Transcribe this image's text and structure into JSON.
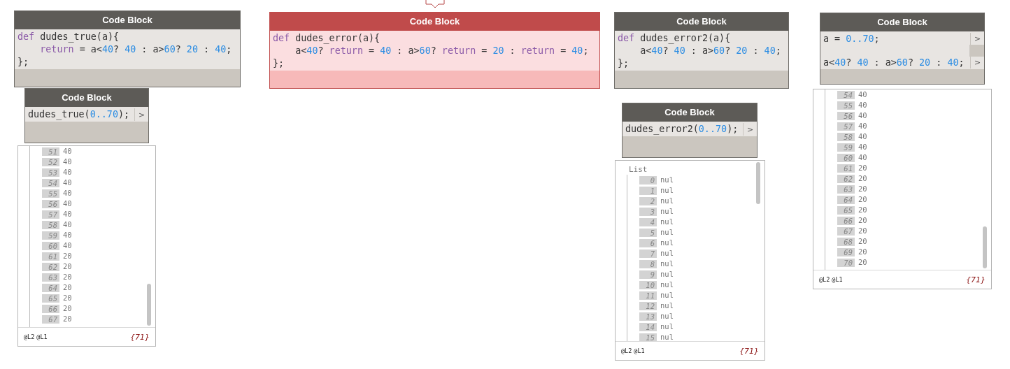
{
  "nodes": [
    {
      "kind": "definition",
      "title": "Code Block",
      "error": false,
      "lines": [
        {
          "indented": false,
          "tokens": [
            {
              "kind": "keyword",
              "text": "def"
            },
            {
              "kind": "plain",
              "text": " dudes_true(a){"
            }
          ]
        },
        {
          "indented": true,
          "tokens": [
            {
              "kind": "keyword",
              "text": "return"
            },
            {
              "kind": "plain",
              "text": " = a<"
            },
            {
              "kind": "number",
              "text": "40"
            },
            {
              "kind": "plain",
              "text": "? "
            },
            {
              "kind": "number",
              "text": "40"
            },
            {
              "kind": "plain",
              "text": " : a>"
            },
            {
              "kind": "number",
              "text": "60"
            },
            {
              "kind": "plain",
              "text": "? "
            },
            {
              "kind": "number",
              "text": "20"
            },
            {
              "kind": "plain",
              "text": " : "
            },
            {
              "kind": "number",
              "text": "40"
            },
            {
              "kind": "plain",
              "text": ";"
            }
          ]
        },
        {
          "indented": false,
          "tokens": [
            {
              "kind": "plain",
              "text": "};"
            }
          ]
        }
      ]
    },
    {
      "kind": "call",
      "title": "Code Block",
      "error": false,
      "lines": [
        {
          "indented": false,
          "output_port": ">",
          "tokens": [
            {
              "kind": "plain",
              "text": "dudes_true("
            },
            {
              "kind": "number",
              "text": "0..70"
            },
            {
              "kind": "plain",
              "text": ");"
            }
          ]
        }
      ]
    },
    {
      "kind": "definition",
      "title": "Code Block",
      "error": true,
      "lines": [
        {
          "indented": false,
          "tokens": [
            {
              "kind": "keyword",
              "text": "def"
            },
            {
              "kind": "plain",
              "text": " dudes_error(a){"
            }
          ]
        },
        {
          "indented": true,
          "tokens": [
            {
              "kind": "plain",
              "text": "a<"
            },
            {
              "kind": "number",
              "text": "40"
            },
            {
              "kind": "plain",
              "text": "? "
            },
            {
              "kind": "keyword",
              "text": "return"
            },
            {
              "kind": "plain",
              "text": " = "
            },
            {
              "kind": "number",
              "text": "40"
            },
            {
              "kind": "plain",
              "text": " : a>"
            },
            {
              "kind": "number",
              "text": "60"
            },
            {
              "kind": "plain",
              "text": "? "
            },
            {
              "kind": "keyword",
              "text": "return"
            },
            {
              "kind": "plain",
              "text": " = "
            },
            {
              "kind": "number",
              "text": "20"
            },
            {
              "kind": "plain",
              "text": " : "
            },
            {
              "kind": "keyword",
              "text": "return"
            },
            {
              "kind": "plain",
              "text": " = "
            },
            {
              "kind": "number",
              "text": "40"
            },
            {
              "kind": "plain",
              "text": ";"
            }
          ]
        },
        {
          "indented": false,
          "tokens": [
            {
              "kind": "plain",
              "text": "};"
            }
          ]
        }
      ]
    },
    {
      "kind": "definition",
      "title": "Code Block",
      "error": false,
      "lines": [
        {
          "indented": false,
          "tokens": [
            {
              "kind": "keyword",
              "text": "def"
            },
            {
              "kind": "plain",
              "text": " dudes_error2(a){"
            }
          ]
        },
        {
          "indented": true,
          "tokens": [
            {
              "kind": "plain",
              "text": "a<"
            },
            {
              "kind": "number",
              "text": "40"
            },
            {
              "kind": "plain",
              "text": "? "
            },
            {
              "kind": "number",
              "text": "40"
            },
            {
              "kind": "plain",
              "text": " : a>"
            },
            {
              "kind": "number",
              "text": "60"
            },
            {
              "kind": "plain",
              "text": "? "
            },
            {
              "kind": "number",
              "text": "20"
            },
            {
              "kind": "plain",
              "text": " : "
            },
            {
              "kind": "number",
              "text": "40"
            },
            {
              "kind": "plain",
              "text": ";"
            }
          ]
        },
        {
          "indented": false,
          "tokens": [
            {
              "kind": "plain",
              "text": "};"
            }
          ]
        }
      ]
    },
    {
      "kind": "call",
      "title": "Code Block",
      "error": false,
      "lines": [
        {
          "indented": false,
          "output_port": ">",
          "tokens": [
            {
              "kind": "plain",
              "text": "dudes_error2("
            },
            {
              "kind": "number",
              "text": "0..70"
            },
            {
              "kind": "plain",
              "text": ");"
            }
          ]
        }
      ]
    },
    {
      "kind": "call",
      "title": "Code Block",
      "error": false,
      "lines": [
        {
          "indented": false,
          "output_port": ">",
          "tokens": [
            {
              "kind": "plain",
              "text": "a = "
            },
            {
              "kind": "number",
              "text": "0..70"
            },
            {
              "kind": "plain",
              "text": ";"
            }
          ]
        },
        {
          "kind": "blank"
        },
        {
          "indented": false,
          "output_port": ">",
          "tokens": [
            {
              "kind": "plain",
              "text": "a<"
            },
            {
              "kind": "number",
              "text": "40"
            },
            {
              "kind": "plain",
              "text": "? "
            },
            {
              "kind": "number",
              "text": "40"
            },
            {
              "kind": "plain",
              "text": " : a>"
            },
            {
              "kind": "number",
              "text": "60"
            },
            {
              "kind": "plain",
              "text": "? "
            },
            {
              "kind": "number",
              "text": "20"
            },
            {
              "kind": "plain",
              "text": " : "
            },
            {
              "kind": "number",
              "text": "40"
            },
            {
              "kind": "plain",
              "text": ";"
            }
          ]
        }
      ]
    }
  ],
  "watches": [
    {
      "items": [
        {
          "index": "51",
          "value": "40"
        },
        {
          "index": "52",
          "value": "40"
        },
        {
          "index": "53",
          "value": "40"
        },
        {
          "index": "54",
          "value": "40"
        },
        {
          "index": "55",
          "value": "40"
        },
        {
          "index": "56",
          "value": "40"
        },
        {
          "index": "57",
          "value": "40"
        },
        {
          "index": "58",
          "value": "40"
        },
        {
          "index": "59",
          "value": "40"
        },
        {
          "index": "60",
          "value": "40"
        },
        {
          "index": "61",
          "value": "20"
        },
        {
          "index": "62",
          "value": "20"
        },
        {
          "index": "63",
          "value": "20"
        },
        {
          "index": "64",
          "value": "20"
        },
        {
          "index": "65",
          "value": "20"
        },
        {
          "index": "66",
          "value": "20"
        },
        {
          "index": "67",
          "value": "20"
        }
      ],
      "levels": [
        "@L2",
        "@L1"
      ],
      "count": "{71}"
    },
    {
      "list_label": "List",
      "items": [
        {
          "index": "0",
          "value": "nul"
        },
        {
          "index": "1",
          "value": "nul"
        },
        {
          "index": "2",
          "value": "nul"
        },
        {
          "index": "3",
          "value": "nul"
        },
        {
          "index": "4",
          "value": "nul"
        },
        {
          "index": "5",
          "value": "nul"
        },
        {
          "index": "6",
          "value": "nul"
        },
        {
          "index": "7",
          "value": "nul"
        },
        {
          "index": "8",
          "value": "nul"
        },
        {
          "index": "9",
          "value": "nul"
        },
        {
          "index": "10",
          "value": "nul"
        },
        {
          "index": "11",
          "value": "nul"
        },
        {
          "index": "12",
          "value": "nul"
        },
        {
          "index": "13",
          "value": "nul"
        },
        {
          "index": "14",
          "value": "nul"
        },
        {
          "index": "15",
          "value": "nul"
        }
      ],
      "levels": [
        "@L2",
        "@L1"
      ],
      "count": "{71}"
    },
    {
      "items": [
        {
          "index": "54",
          "value": "40"
        },
        {
          "index": "55",
          "value": "40"
        },
        {
          "index": "56",
          "value": "40"
        },
        {
          "index": "57",
          "value": "40"
        },
        {
          "index": "58",
          "value": "40"
        },
        {
          "index": "59",
          "value": "40"
        },
        {
          "index": "60",
          "value": "40"
        },
        {
          "index": "61",
          "value": "20"
        },
        {
          "index": "62",
          "value": "20"
        },
        {
          "index": "63",
          "value": "20"
        },
        {
          "index": "64",
          "value": "20"
        },
        {
          "index": "65",
          "value": "20"
        },
        {
          "index": "66",
          "value": "20"
        },
        {
          "index": "67",
          "value": "20"
        },
        {
          "index": "68",
          "value": "20"
        },
        {
          "index": "69",
          "value": "20"
        },
        {
          "index": "70",
          "value": "20"
        }
      ],
      "levels": [
        "@L2",
        "@L1"
      ],
      "count": "{71}"
    }
  ]
}
